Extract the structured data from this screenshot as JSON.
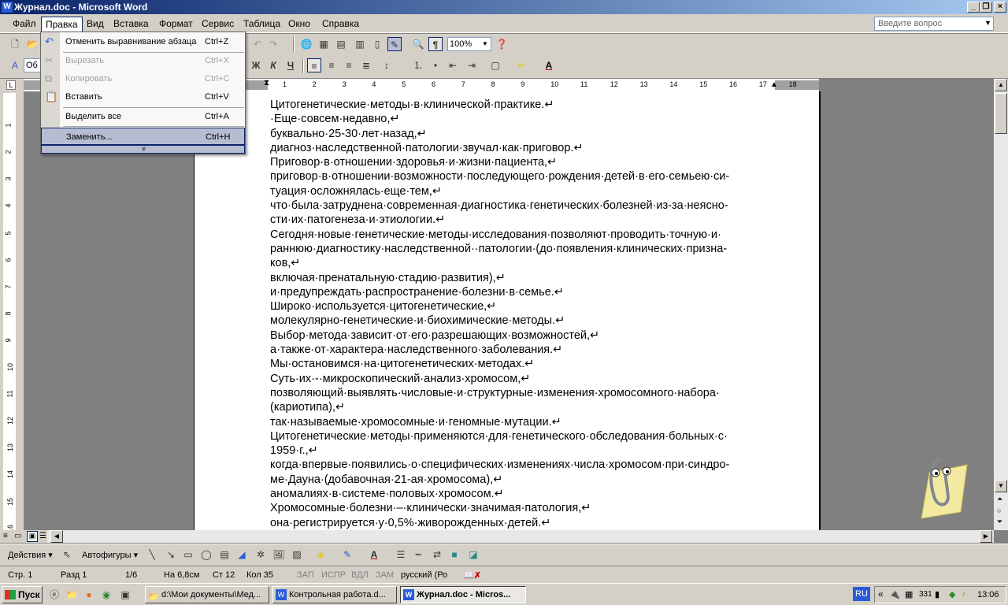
{
  "window": {
    "title": "Журнал.doc - Microsoft Word"
  },
  "menubar": {
    "items": [
      "Файл",
      "Правка",
      "Вид",
      "Вставка",
      "Формат",
      "Сервис",
      "Таблица",
      "Окно",
      "Справка"
    ],
    "help_placeholder": "Введите вопрос"
  },
  "toolbar": {
    "zoom": "100%",
    "style_value": "Об"
  },
  "edit_menu": {
    "items": [
      {
        "label": "Отменить выравнивание абзаца",
        "key": "Ctrl+Z",
        "icon": "undo-icon"
      },
      {
        "label": "Вырезать",
        "key": "Ctrl+X",
        "icon": "scissors-icon",
        "disabled": true
      },
      {
        "label": "Копировать",
        "key": "Ctrl+C",
        "icon": "copy-icon",
        "disabled": true
      },
      {
        "label": "Вставить",
        "key": "Ctrl+V",
        "icon": "paste-icon"
      },
      {
        "label": "Выделить все",
        "key": "Ctrl+A"
      },
      {
        "label": "Заменить...",
        "key": "Ctrl+H",
        "highlighted": true
      }
    ],
    "expand_glyph": "»"
  },
  "ruler_numbers": [
    "1",
    "2",
    "3",
    "4",
    "5",
    "6",
    "7",
    "8",
    "9",
    "10",
    "11",
    "12",
    "13",
    "14",
    "15",
    "16",
    "17",
    "18"
  ],
  "document": {
    "lines": [
      "Цитогенетические·методы·в·клинической·практике.↵",
      "·Еще·совсем·недавно,↵",
      "буквально·25-30·лет·назад,↵",
      "диагноз·наследственной·патологии·звучал·как·приговор.↵",
      "Приговор·в·отношении·здоровья·и·жизни·пациента,↵",
      "приговор·в·отношении·возможности·последующего·рождения·детей·в·его·семьею·си-",
      "туация·осложнялась·еще·тем,↵",
      "что·была·затруднена·современная·диагностика·генетических·болезней·из-за·неясно-",
      "сти·их·патогенеза·и·этиологии.↵",
      "Сегодня·новые·генетические·методы·исследования·позволяют·проводить·точную·и·",
      "раннюю·диагностику·наследственной··патологии·(до·появления·клинических·призна-",
      "ков,↵",
      "включая·пренатальную·стадию·развития),↵",
      "и·предупреждать·распространение·болезни·в·семье.↵",
      "Широко·используется·цитогенетические,↵",
      "молекулярно-генетические·и·биохимические·методы.↵",
      "Выбор·метода·зависит·от·его·разрешающих·возможностей,↵",
      "а·также·от·характера·наследственного·заболевания.↵",
      "Мы·остановимся·на·цитогенетических·методах.↵",
      "Суть·их·-·микроскопический·анализ·хромосом,↵",
      "позволяющий·выявлять·числовые·и·структурные·изменения·хромосомного·набора·",
      "(кариотипа),↵",
      "так·называемые·хромосомные·и·геномные·мутации.↵",
      "Цитогенетические·методы·применяются·для·генетического·обследования·больных·с·",
      "1959·г.,↵",
      "когда·впервые·появились·о·специфических·изменениях·числа·хромосом·при·синдро-",
      "ме·Дауна·(добавочная·21-ая·хромосома),↵",
      "аномалиях·в·системе·половых·хромосом.↵",
      "Хромосомные·болезни·–·клинически·значимая·патология,↵",
      "она·регистрируется·у·0,5%·живорожденных·детей.↵"
    ]
  },
  "drawbar": {
    "actions": "Действия",
    "autoshapes": "Автофигуры"
  },
  "status": {
    "page": "Стр. 1",
    "section": "Разд 1",
    "pages": "1/6",
    "at": "На 6,8см",
    "line": "Ст 12",
    "col": "Кол 35",
    "rec": "ЗАП",
    "trk": "ИСПР",
    "ext": "ВДЛ",
    "ovr": "ЗАМ",
    "lang": "русский (Ро"
  },
  "taskbar": {
    "start": "Пуск",
    "tasks": [
      {
        "label": "d:\\Мои документы\\Мед..."
      },
      {
        "label": "Контрольная работа.d..."
      },
      {
        "label": "Журнал.doc - Micros...",
        "active": true
      }
    ],
    "lang": "RU",
    "clock": "13:06",
    "tray_text": "331"
  }
}
